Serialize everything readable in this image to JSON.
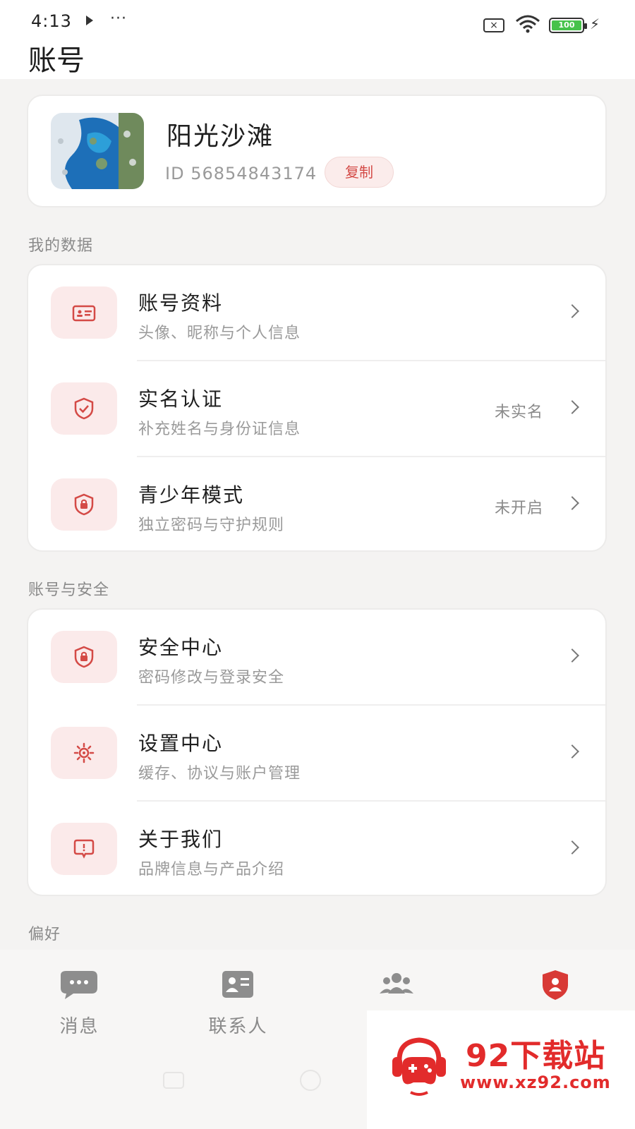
{
  "status_bar": {
    "time": "4:13",
    "more": "···",
    "sim_label": "×",
    "battery": "100",
    "bolt": "⚡"
  },
  "header": {
    "title": "账号"
  },
  "profile": {
    "name": "阳光沙滩",
    "id_text": "ID 56854843174",
    "copy_label": "复制"
  },
  "sections": {
    "my_data": "我的数据",
    "account_security": "账号与安全",
    "preferences": "偏好"
  },
  "my_data_items": [
    {
      "title": "账号资料",
      "subtitle": "头像、昵称与个人信息",
      "status": "",
      "icon": "id-card-icon"
    },
    {
      "title": "实名认证",
      "subtitle": "补充姓名与身份证信息",
      "status": "未实名",
      "icon": "shield-check-icon"
    },
    {
      "title": "青少年模式",
      "subtitle": "独立密码与守护规则",
      "status": "未开启",
      "icon": "shield-lock-icon"
    }
  ],
  "security_items": [
    {
      "title": "安全中心",
      "subtitle": "密码修改与登录安全",
      "icon": "shield-lock-icon"
    },
    {
      "title": "设置中心",
      "subtitle": "缓存、协议与账户管理",
      "icon": "gear-icon"
    },
    {
      "title": "关于我们",
      "subtitle": "品牌信息与产品介绍",
      "icon": "info-bubble-icon"
    }
  ],
  "tabs": [
    {
      "label": "消息",
      "icon": "chat-bubble-icon",
      "active": false
    },
    {
      "label": "联系人",
      "icon": "contact-card-icon",
      "active": false
    },
    {
      "label": "",
      "icon": "group-icon",
      "active": false
    },
    {
      "label": "",
      "icon": "shield-user-icon",
      "active": true
    }
  ],
  "watermark": {
    "title": "92下载站",
    "url": "www.xz92.com"
  },
  "colors": {
    "accent": "#d44a46",
    "icon_bg": "#fbeaea",
    "background": "#f4f3f2",
    "watermark_red": "#e22b2b"
  }
}
